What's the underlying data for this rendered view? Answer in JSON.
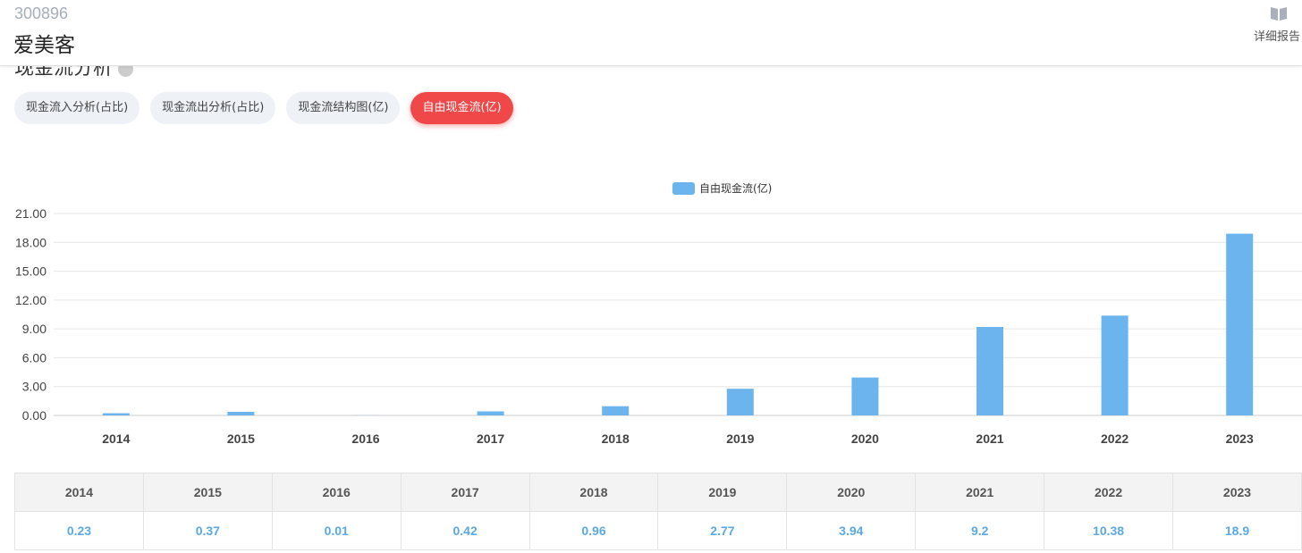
{
  "header": {
    "stock_code": "300896",
    "stock_name": "爱美客",
    "report_label": "详细报告"
  },
  "section": {
    "title": "现金流分析"
  },
  "tabs": [
    {
      "label": "现金流入分析(占比)",
      "active": false
    },
    {
      "label": "现金流出分析(占比)",
      "active": false
    },
    {
      "label": "现金流结构图(亿)",
      "active": false
    },
    {
      "label": "自由现金流(亿)",
      "active": true
    }
  ],
  "colors": {
    "bar": "#6cb4ee",
    "active_tab": "#f04848"
  },
  "chart_data": {
    "type": "bar",
    "categories": [
      "2014",
      "2015",
      "2016",
      "2017",
      "2018",
      "2019",
      "2020",
      "2021",
      "2022",
      "2023"
    ],
    "series": [
      {
        "name": "自由现金流(亿)",
        "values": [
          0.23,
          0.37,
          0.01,
          0.42,
          0.96,
          2.77,
          3.94,
          9.2,
          10.38,
          18.9
        ]
      }
    ],
    "yticks": [
      "0.00",
      "3.00",
      "6.00",
      "9.00",
      "12.00",
      "15.00",
      "18.00",
      "21.00"
    ],
    "ylim": [
      0,
      21
    ],
    "legend_position": "top-center",
    "grid": true
  },
  "table": {
    "headers": [
      "2014",
      "2015",
      "2016",
      "2017",
      "2018",
      "2019",
      "2020",
      "2021",
      "2022",
      "2023"
    ],
    "values": [
      "0.23",
      "0.37",
      "0.01",
      "0.42",
      "0.96",
      "2.77",
      "3.94",
      "9.2",
      "10.38",
      "18.9"
    ]
  }
}
